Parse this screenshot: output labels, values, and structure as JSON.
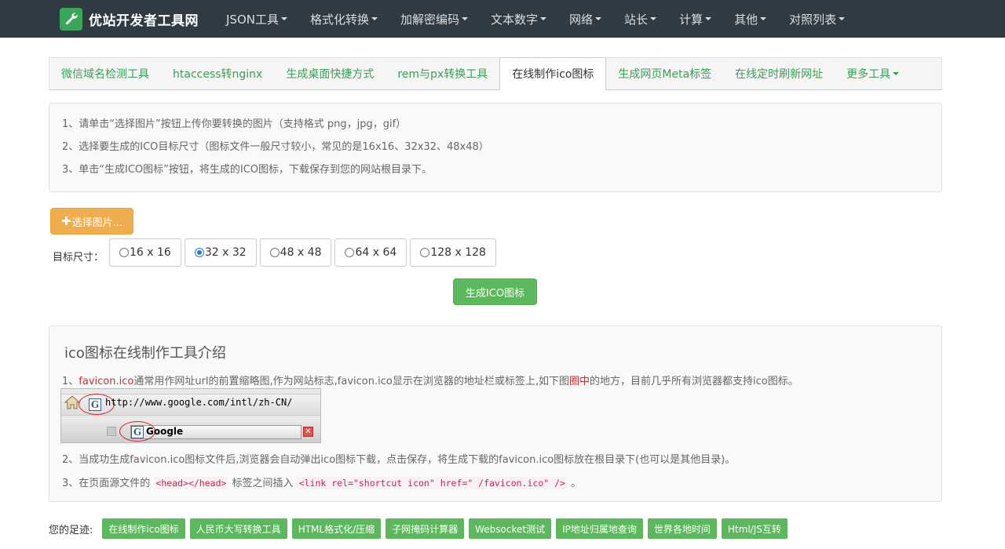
{
  "nav": {
    "brand": "优站开发者工具网",
    "items": [
      {
        "label": "JSON工具"
      },
      {
        "label": "格式化转换"
      },
      {
        "label": "加解密编码"
      },
      {
        "label": "文本数字"
      },
      {
        "label": "网络"
      },
      {
        "label": "站长"
      },
      {
        "label": "计算"
      },
      {
        "label": "其他"
      },
      {
        "label": "对照列表"
      }
    ]
  },
  "tabs": [
    {
      "label": "微信域名检测工具"
    },
    {
      "label": "htaccess转nginx"
    },
    {
      "label": "生成桌面快捷方式"
    },
    {
      "label": "rem与px转换工具"
    },
    {
      "label": "在线制作ico图标",
      "active": true
    },
    {
      "label": "生成网页Meta标签"
    },
    {
      "label": "在线定时刷新网址"
    },
    {
      "label": "更多工具"
    }
  ],
  "instructions": [
    "1、请单击“选择图片”按钮上传你要转换的图片（支持格式 png，jpg，gif）",
    "2、选择要生成的ICO目标尺寸（图标文件一般尺寸较小，常见的是16x16、32x32、48x48）",
    "3、单击“生成ICO图标”按钮，将生成的ICO图标，下载保存到您的网站根目录下。"
  ],
  "upload": {
    "label": "选择图片..."
  },
  "size": {
    "label": "目标尺寸：",
    "options": [
      {
        "label": "16 x 16",
        "checked": false
      },
      {
        "label": "32 x 32",
        "checked": true
      },
      {
        "label": "48 x 48",
        "checked": false
      },
      {
        "label": "64 x 64",
        "checked": false
      },
      {
        "label": "128 x 128",
        "checked": false
      }
    ]
  },
  "generate": {
    "label": "生成ICO图标"
  },
  "intro": {
    "title": "ico图标在线制作工具介绍",
    "p1_prefix": "1、",
    "p1_highlight": "favicon.ico",
    "p1_mid": "通常用作网址url的前置缩略图,作为网站标志,favicon.ico显示在浏览器的地址栏或标签上,如下图",
    "p1_red": "圈中",
    "p1_suffix": "的地方，目前几乎所有浏览器都支持ico图标。",
    "demo_url": "http://www.google.com/intl/zh-CN/",
    "demo_tab": "Google",
    "demo_icon_letter": "G",
    "p2": "2、当成功生成favicon.ico图标文件后,浏览器会自动弹出ico图标下载，点击保存，将生成下载的favicon.ico图标放在根目录下(也可以是其他目录)。",
    "p3_prefix": "3、在页面源文件的 ",
    "p3_code1": "<head></head>",
    "p3_mid": " 标签之间插入 ",
    "p3_code2": "<link rel=\"shortcut icon\" href=\" /favicon.ico\" />",
    "p3_suffix": " 。"
  },
  "footprint": {
    "label": "您的足迹:",
    "tags": [
      {
        "label": "在线制作ico图标"
      },
      {
        "label": "人民币大写转换工具"
      },
      {
        "label": "HTML格式化/压缩"
      },
      {
        "label": "子网掩码计算器"
      },
      {
        "label": "Websocket测试"
      },
      {
        "label": "IP地址归属地查询"
      },
      {
        "label": "世界各地时间"
      },
      {
        "label": "Html/JS互转"
      }
    ]
  }
}
